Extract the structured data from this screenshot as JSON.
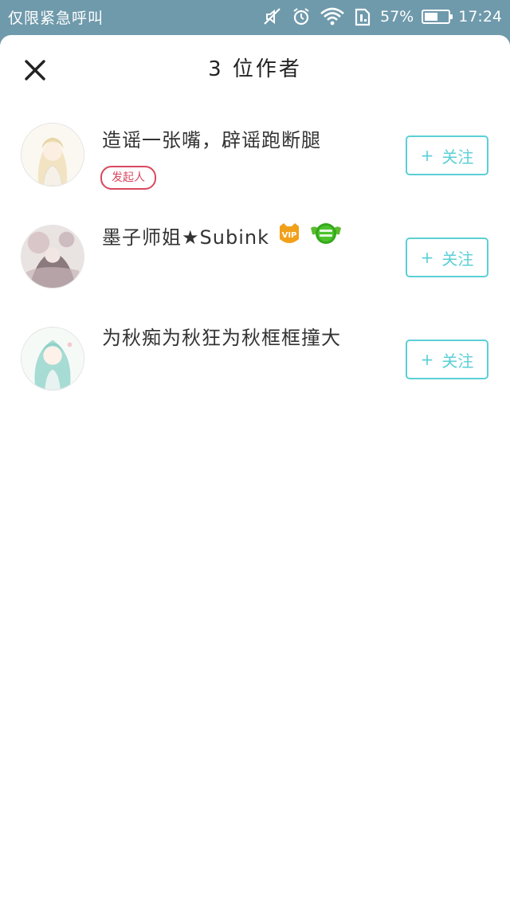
{
  "status_bar": {
    "emergency_text": "仅限紧急呼叫",
    "battery_percent": "57%",
    "battery_level": 0.57,
    "time": "17:24"
  },
  "header": {
    "title": "3 位作者"
  },
  "authors": [
    {
      "name": "造谣一张嘴，辟谣跑断腿",
      "tag": "发起人",
      "follow_plus": "+",
      "follow_label": "关注"
    },
    {
      "name": "墨子师姐★Subink",
      "vip_badge": "VIP",
      "follow_plus": "+",
      "follow_label": "关注"
    },
    {
      "name": "为秋痴为秋狂为秋框框撞大",
      "follow_plus": "+",
      "follow_label": "关注"
    }
  ],
  "colors": {
    "status_bg": "#6f9aab",
    "accent": "#5ccfd6",
    "tag": "#d9485f"
  }
}
